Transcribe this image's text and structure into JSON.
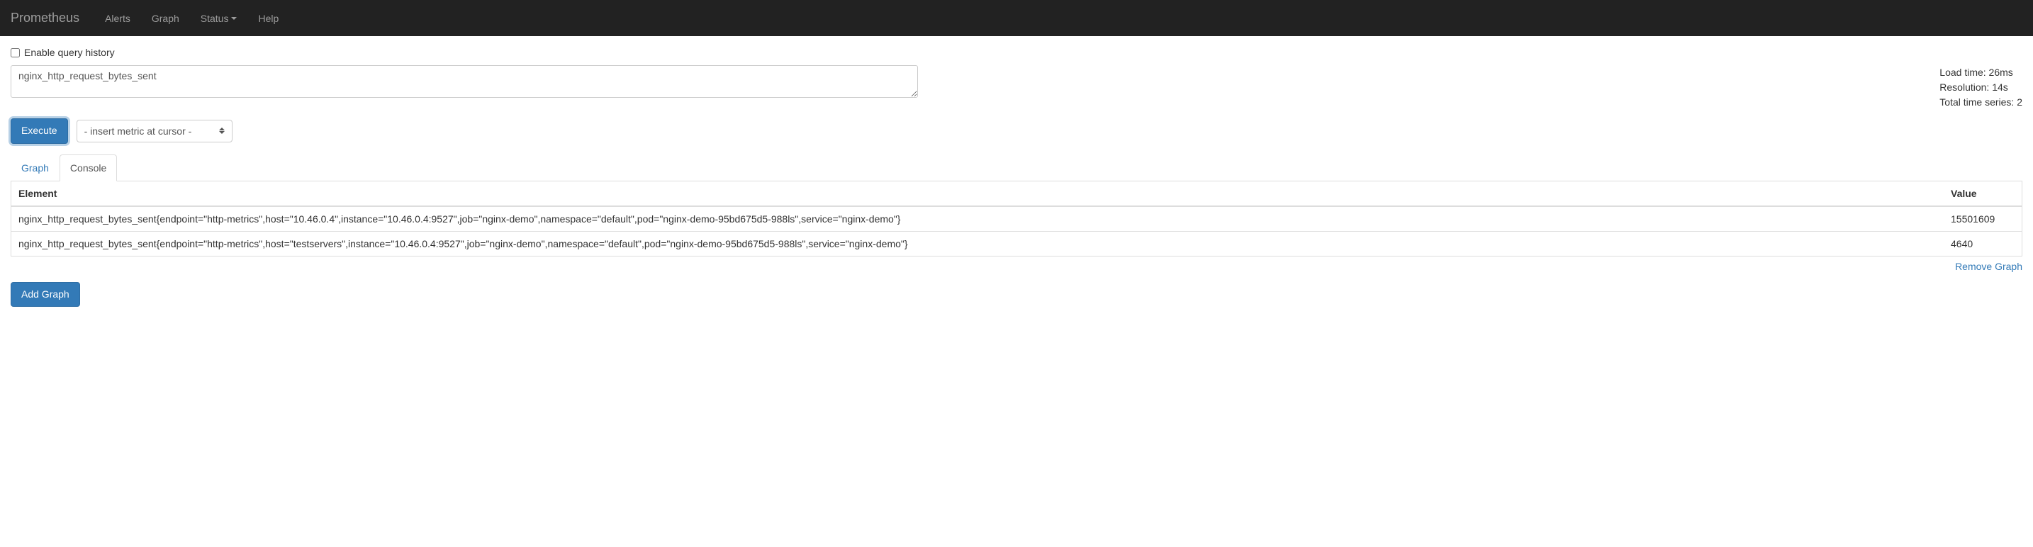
{
  "navbar": {
    "brand": "Prometheus",
    "items": [
      {
        "label": "Alerts"
      },
      {
        "label": "Graph"
      },
      {
        "label": "Status",
        "caret": true
      },
      {
        "label": "Help"
      }
    ]
  },
  "enable_history_label": "Enable query history",
  "query_value": "nginx_http_request_bytes_sent",
  "stats": {
    "load_time": "Load time: 26ms",
    "resolution": "Resolution: 14s",
    "total_series": "Total time series: 2"
  },
  "execute_label": "Execute",
  "metric_select_placeholder": "- insert metric at cursor -",
  "tabs": {
    "graph": "Graph",
    "console": "Console"
  },
  "table": {
    "headers": {
      "element": "Element",
      "value": "Value"
    },
    "rows": [
      {
        "element": "nginx_http_request_bytes_sent{endpoint=\"http-metrics\",host=\"10.46.0.4\",instance=\"10.46.0.4:9527\",job=\"nginx-demo\",namespace=\"default\",pod=\"nginx-demo-95bd675d5-988ls\",service=\"nginx-demo\"}",
        "value": "15501609"
      },
      {
        "element": "nginx_http_request_bytes_sent{endpoint=\"http-metrics\",host=\"testservers\",instance=\"10.46.0.4:9527\",job=\"nginx-demo\",namespace=\"default\",pod=\"nginx-demo-95bd675d5-988ls\",service=\"nginx-demo\"}",
        "value": "4640"
      }
    ]
  },
  "remove_graph_label": "Remove Graph",
  "add_graph_label": "Add Graph"
}
